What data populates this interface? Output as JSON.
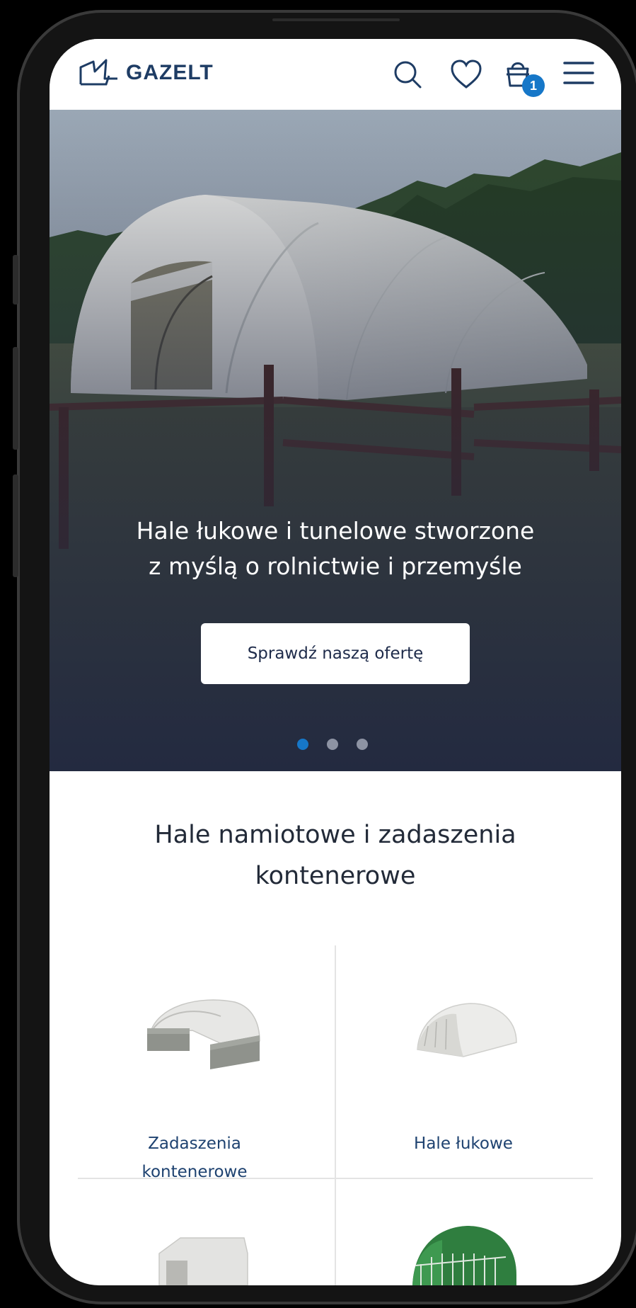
{
  "brand": {
    "name": "GAZELT",
    "color": "#1e3c64"
  },
  "header": {
    "icons": [
      "search-icon",
      "heart-icon",
      "cart-icon",
      "menu-icon"
    ],
    "cart_count": "1",
    "accent": "#1677c8"
  },
  "hero": {
    "title_line1": "Hale łukowe i tunelowe stworzone",
    "title_line2": "z myślą o rolnictwie i przemyśle",
    "cta_label": "Sprawdź naszą ofertę",
    "slides": 3,
    "active_slide": 1
  },
  "section": {
    "title_line1": "Hale namiotowe i zadaszenia",
    "title_line2": "kontenerowe"
  },
  "categories": [
    {
      "label_line1": "Zadaszenia",
      "label_line2": "kontenerowe"
    },
    {
      "label_line1": "Hale łukowe",
      "label_line2": ""
    }
  ]
}
